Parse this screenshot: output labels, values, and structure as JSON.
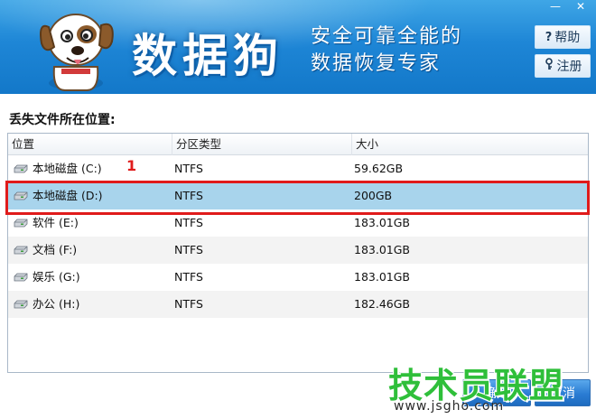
{
  "header": {
    "brand": "数据狗",
    "slogan_line1": "安全可靠全能的",
    "slogan_line2": "数据恢复专家",
    "help_label": "帮助",
    "register_label": "注册",
    "minimize_glyph": "—",
    "close_glyph": "✕"
  },
  "section_label": "丢失文件所在位置:",
  "list": {
    "columns": [
      "位置",
      "分区类型",
      "大小"
    ],
    "rows": [
      {
        "location": "本地磁盘 (C:)",
        "fs": "NTFS",
        "size": "59.62GB"
      },
      {
        "location": "本地磁盘 (D:)",
        "fs": "NTFS",
        "size": "200GB"
      },
      {
        "location": "软件 (E:)",
        "fs": "NTFS",
        "size": "183.01GB"
      },
      {
        "location": "文档 (F:)",
        "fs": "NTFS",
        "size": "183.01GB"
      },
      {
        "location": "娱乐 (G:)",
        "fs": "NTFS",
        "size": "183.01GB"
      },
      {
        "location": "办公 (H:)",
        "fs": "NTFS",
        "size": "182.46GB"
      }
    ],
    "selected_index": 1
  },
  "annotation": {
    "number": "1",
    "color": "#e01b1b"
  },
  "buttons": {
    "ok_label": "确定",
    "cancel_label": "取消"
  },
  "watermark": {
    "main": "技术员联盟",
    "sub": "www.jsgho.com"
  },
  "colors": {
    "header_blue": "#1e86d6",
    "selected_row": "#a8d4ec",
    "watermark_green": "#2fbf3a"
  }
}
